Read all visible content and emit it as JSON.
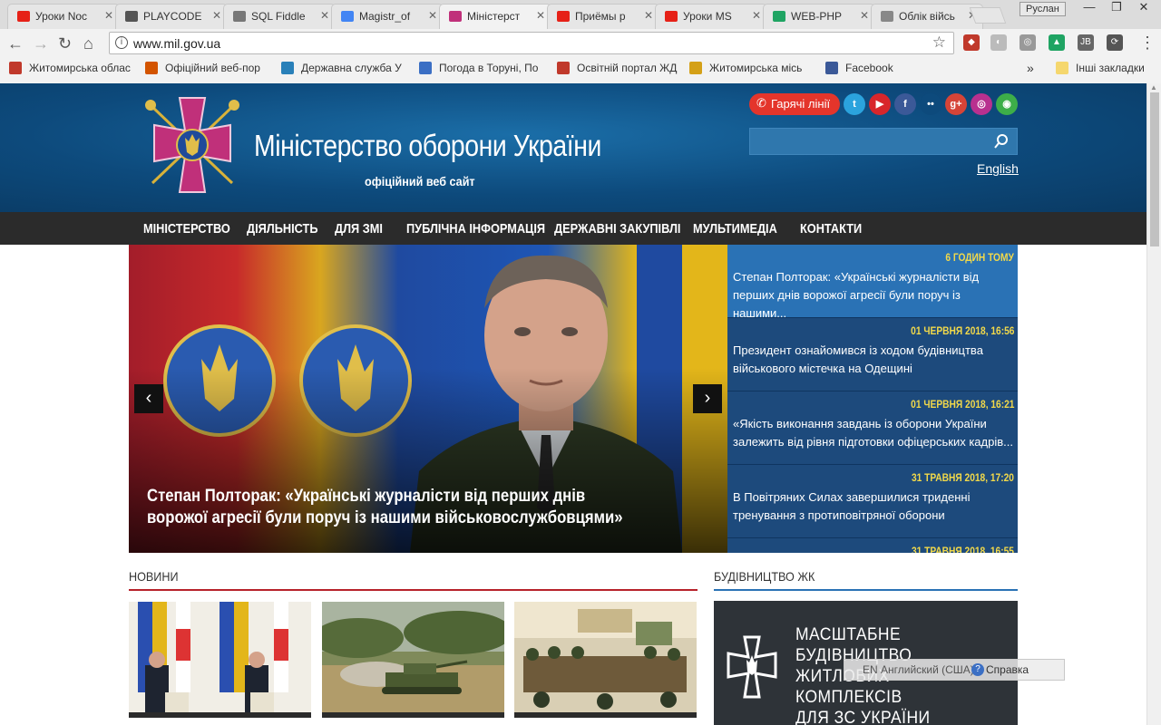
{
  "browser": {
    "tabs": [
      {
        "label": "Уроки Noc",
        "icon": "youtube-icon",
        "color": "#e62117"
      },
      {
        "label": "PLAYCODE",
        "icon": "play-icon",
        "color": "#555555"
      },
      {
        "label": "SQL Fiddle",
        "icon": "gear-icon",
        "color": "#777777"
      },
      {
        "label": "Magistr_of",
        "icon": "docs-icon",
        "color": "#4285f4"
      },
      {
        "label": "Міністерст",
        "icon": "mil-cross-icon",
        "color": "#c0307a"
      },
      {
        "label": "Приёмы р",
        "icon": "youtube-icon",
        "color": "#e62117"
      },
      {
        "label": "Уроки MS",
        "icon": "youtube-icon",
        "color": "#e62117"
      },
      {
        "label": "WEB-PHP",
        "icon": "drive-icon",
        "color": "#1fa463"
      },
      {
        "label": "Облік війсь",
        "icon": "page-icon",
        "color": "#888888"
      }
    ],
    "user": "Руслан",
    "window_controls": {
      "minimize": "—",
      "maximize": "❐",
      "close": "✕"
    },
    "url": "www.mil.gov.ua",
    "bookmarks": [
      {
        "label": "Житомирська облас",
        "color": "#c0392b"
      },
      {
        "label": "Офіційний веб-пор",
        "color": "#d35400"
      },
      {
        "label": "Державна служба У",
        "color": "#2980b9"
      },
      {
        "label": "Погода в Торуні, По",
        "color": "#3b6fc4"
      },
      {
        "label": "Освітній портал ЖД",
        "color": "#c0392b"
      },
      {
        "label": "Житомирська місь",
        "color": "#d4a017"
      },
      {
        "label": "Facebook",
        "color": "#3b5998"
      }
    ],
    "bookmarks_more": "»",
    "other_bookmarks": "Інші закладки"
  },
  "site": {
    "title": "Міністерство оборони України",
    "subtitle": "офіційний веб сайт",
    "hotlines": "Гарячі лінії",
    "language_link": "English",
    "search_placeholder": "",
    "social": [
      {
        "name": "twitter-icon",
        "glyph": "t",
        "color": "#2ba3dd"
      },
      {
        "name": "youtube-icon",
        "glyph": "▶",
        "color": "#d8262b"
      },
      {
        "name": "facebook-icon",
        "glyph": "f",
        "color": "#3b5998"
      },
      {
        "name": "flickr-icon",
        "glyph": "••",
        "color": "#0d4a7c"
      },
      {
        "name": "googleplus-icon",
        "glyph": "g+",
        "color": "#d64437"
      },
      {
        "name": "instagram-icon",
        "glyph": "◎",
        "color": "#b8308f"
      },
      {
        "name": "eye-icon",
        "glyph": "◉",
        "color": "#3dae49"
      }
    ],
    "nav": [
      "МІНІСТЕРСТВО",
      "ДІЯЛЬНІСТЬ",
      "ДЛЯ ЗМІ",
      "ПУБЛІЧНА ІНФОРМАЦІЯ",
      "ДЕРЖАВНІ ЗАКУПІВЛІ",
      "МУЛЬТИМЕДІА",
      "КОНТАКТИ"
    ],
    "hero": {
      "caption": "Степан Полторак: «Українські журналісти від перших днів ворожої агресії були поруч із нашими військовослужбовцями»",
      "prev": "‹",
      "next": "›"
    },
    "feed": [
      {
        "date": "6 ГОДИН ТОМУ",
        "text": "Степан Полторак: «Українські журналісти від перших днів ворожої агресії були поруч із нашими..."
      },
      {
        "date": "01 ЧЕРВНЯ 2018, 16:56",
        "text": "Президент ознайомився із ходом будівництва військового містечка на Одещині"
      },
      {
        "date": "01 ЧЕРВНЯ 2018, 16:21",
        "text": "«Якість виконання завдань із оборони України залежить від рівня підготовки офіцерських кадрів..."
      },
      {
        "date": "31 ТРАВНЯ 2018, 17:20",
        "text": "В Повітряних Силах завершилися триденні тренування з протиповітряної оборони"
      },
      {
        "date": "31 ТРАВНЯ 2018, 16:55",
        "text": ""
      }
    ],
    "news_title": "НОВИНИ",
    "construction_title": "БУДІВНИЦТВО ЖК",
    "promo_lines": [
      "МАСШТАБНЕ",
      "БУДІВНИЦТВО",
      "ЖИТЛОВИХ КОМПЛЕКСІВ",
      "ДЛЯ ЗС УКРАЇНИ"
    ]
  },
  "ime_bar": {
    "language": "EN Английский (США)",
    "help": "Справка"
  },
  "colors": {
    "header_blue": "#0d4a7c",
    "nav_dark": "#2b2b2b",
    "feed_blue": "#1d4a7c",
    "accent_red": "#c0392b",
    "date_yellow": "#f2d94a"
  }
}
